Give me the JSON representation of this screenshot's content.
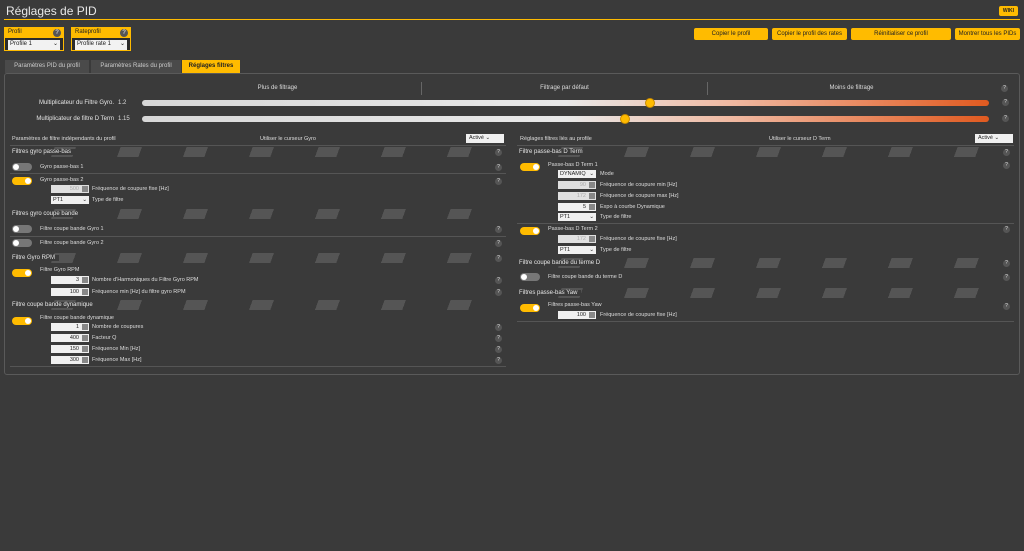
{
  "header": {
    "title": "Réglages de PID",
    "wiki": "WIKI"
  },
  "profile": {
    "label": "Profil",
    "value": "Profile 1"
  },
  "rateprofile": {
    "label": "Rateprofil",
    "value": "Profile rate 1"
  },
  "buttons": {
    "copy_profile": "Copier le profil",
    "copy_rates": "Copier le profil des rates",
    "reset": "Réinitialiser ce profil",
    "show_all": "Montrer tous les PIDs"
  },
  "tabs": {
    "pid": "Paramètres PID du profil",
    "rates": "Paramètres Rates du profil",
    "filters": "Réglages filtres"
  },
  "slider_head": {
    "more": "Plus de filtrage",
    "default": "Filtrage par défaut",
    "less": "Moins de filtrage"
  },
  "sliders": {
    "gyro": {
      "label": "Multiplicateur du Filtre Gyro.",
      "value": "1.2",
      "level": 0.6
    },
    "dterm": {
      "label": "Multiplicateur de filtre D Term",
      "value": "1.15",
      "level": 0.57
    }
  },
  "left": {
    "header": "Paramètres de filtre indépendants du profil",
    "cursor": "Utiliser le curseur Gyro",
    "active": "Activé",
    "gyro_lpf": {
      "title": "Filtres gyro passe-bas",
      "lpf1": "Gyro passe-bas 1",
      "lpf2": "Gyro passe-bas 2",
      "cutoff_val": "500",
      "cutoff": "Fréquence de coupure fixe [Hz]",
      "type_val": "PT1",
      "type": "Type de filtre"
    },
    "notch": {
      "title": "Filtres gyro coupe bande",
      "n1": "Filtre coupe bande Gyro 1",
      "n2": "Filtre coupe bande Gyro 2"
    },
    "rpm": {
      "title": "Filtre Gyro RPM",
      "name": "Filtre Gyro RPM",
      "harm_val": "3",
      "harm": "Nombre d'Harmoniques du Filtre Gyro RPM",
      "min_val": "100",
      "min": "Fréquence min [Hz] du filtre gyro RPM"
    },
    "dyn": {
      "title": "Filtre coupe bande dynamique",
      "name": "Filtre coupe bande dynamique",
      "count_val": "1",
      "count": "Nombre de coupures",
      "q_val": "400",
      "q": "Facteur Q",
      "fmin_val": "150",
      "fmin": "Fréquence Min [Hz]",
      "fmax_val": "300",
      "fmax": "Fréquence Max [Hz]"
    }
  },
  "right": {
    "header": "Réglages filtres liés au profile",
    "cursor": "Utiliser le curseur D Term",
    "active": "Activé",
    "dterm": {
      "title": "Filtre passe-bas D Term",
      "lpf1": "Passe-bas D Term 1",
      "mode_val": "DYNAMIQ",
      "mode": "Mode",
      "fmin_val": "90",
      "fmin": "Fréquence de coupure min [Hz]",
      "fmax_val": "172",
      "fmax": "Fréquence de coupure max [Hz]",
      "expo_val": "5",
      "expo": "Expo à courbe Dynamique",
      "type_val": "PT1",
      "type": "Type de filtre",
      "lpf2": "Passe-bas D Term 2",
      "cut2_val": "172",
      "cut2": "Fréquence de coupure fixe [Hz]",
      "type2_val": "PT1",
      "type2": "Type de filtre"
    },
    "dnotch": {
      "title": "Filtre coupe bande du terme D",
      "name": "Filtre coupe bande du terme D"
    },
    "yaw": {
      "title": "Filtres passe-bas Yaw",
      "name": "Filtres passe-bas Yaw",
      "cut_val": "100",
      "cut": "Fréquence de coupure fixe [Hz]"
    }
  },
  "colors": {
    "accent": "#ffbb00",
    "bg": "#3a3a3a"
  }
}
